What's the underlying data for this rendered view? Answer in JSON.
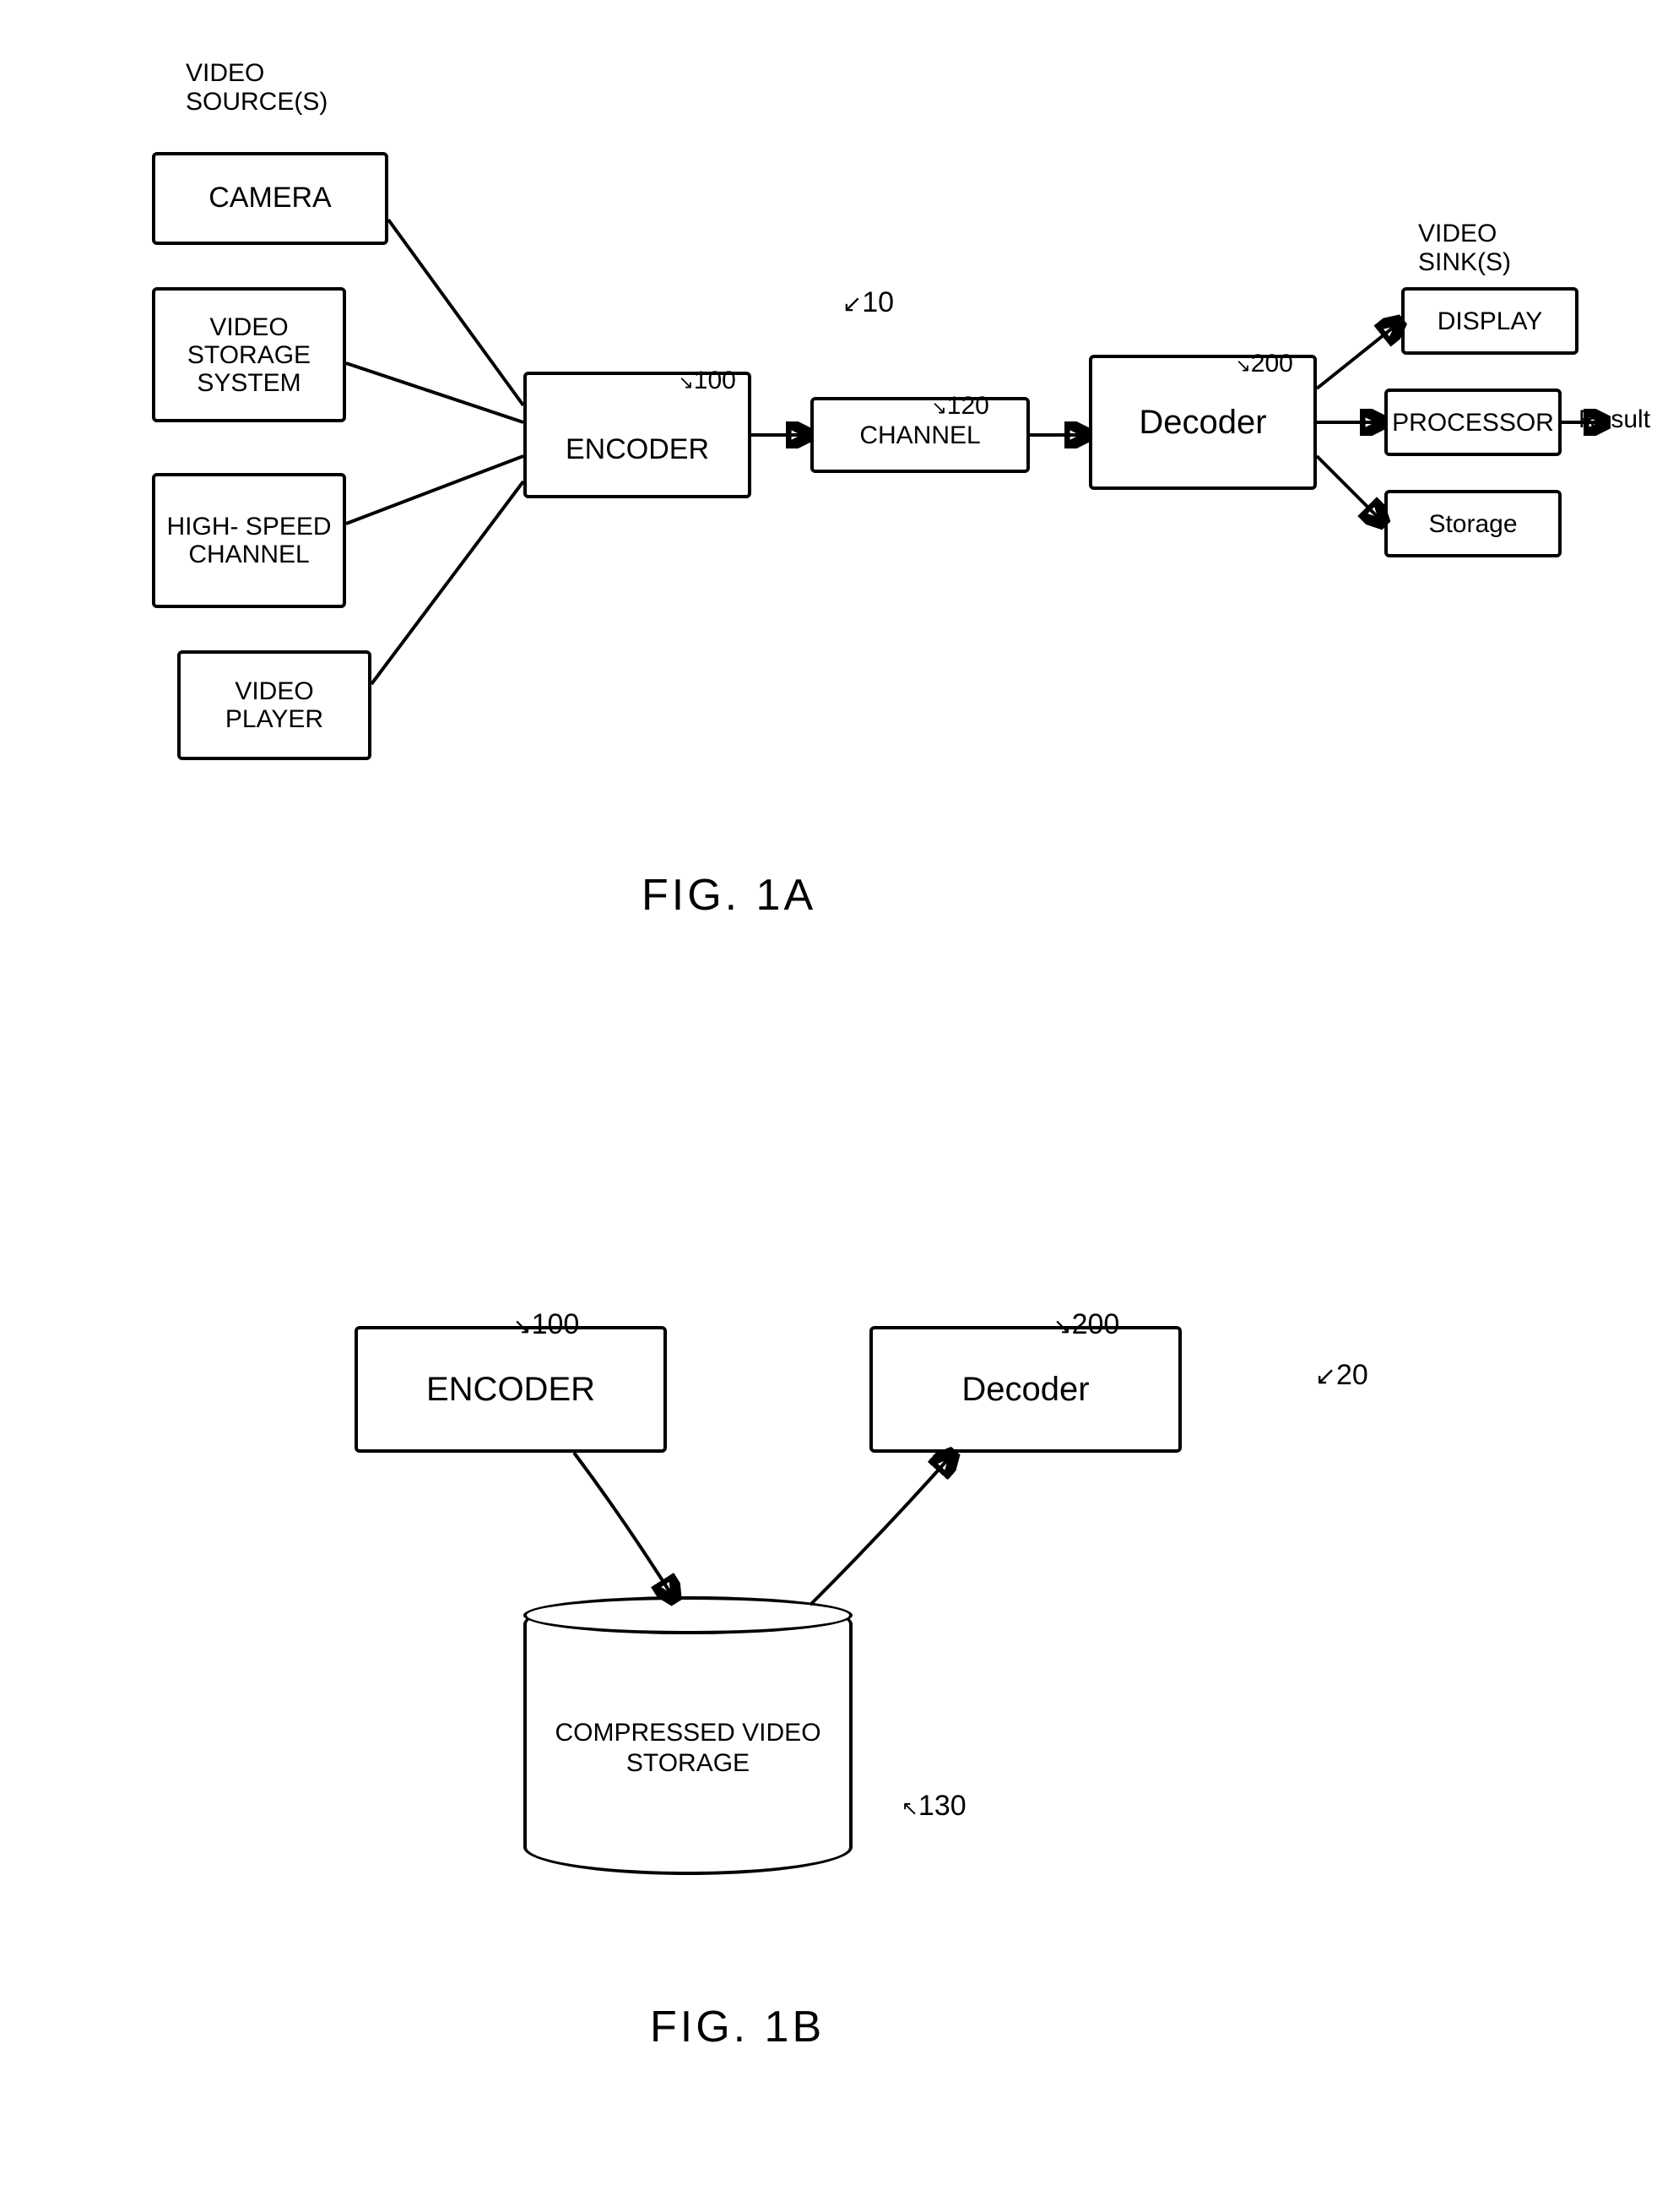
{
  "figA": {
    "title_sources": "VIDEO\nSOURCE(S)",
    "camera": "CAMERA",
    "storage_system": "VIDEO\nSTORAGE\nSYSTEM",
    "high_speed": "HIGH-\nSPEED\nCHANNEL",
    "video_player": "VIDEO\nPLAYER",
    "encoder": "ENCODER",
    "channel": "CHANNEL",
    "decoder": "Decoder",
    "title_sinks": "VIDEO\nSINK(S)",
    "display": "DISPLAY",
    "processor": "PROCESSOR",
    "storage_sink": "Storage",
    "result": "Result",
    "ref_10": "10",
    "ref_100": "100",
    "ref_120": "120",
    "ref_200": "200",
    "caption": "FIG. 1A"
  },
  "figB": {
    "encoder": "ENCODER",
    "decoder": "Decoder",
    "compressed": "COMPRESSED\nVIDEO\nSTORAGE",
    "ref_100": "100",
    "ref_200": "200",
    "ref_20": "20",
    "ref_130": "130",
    "caption": "FIG. 1B"
  }
}
